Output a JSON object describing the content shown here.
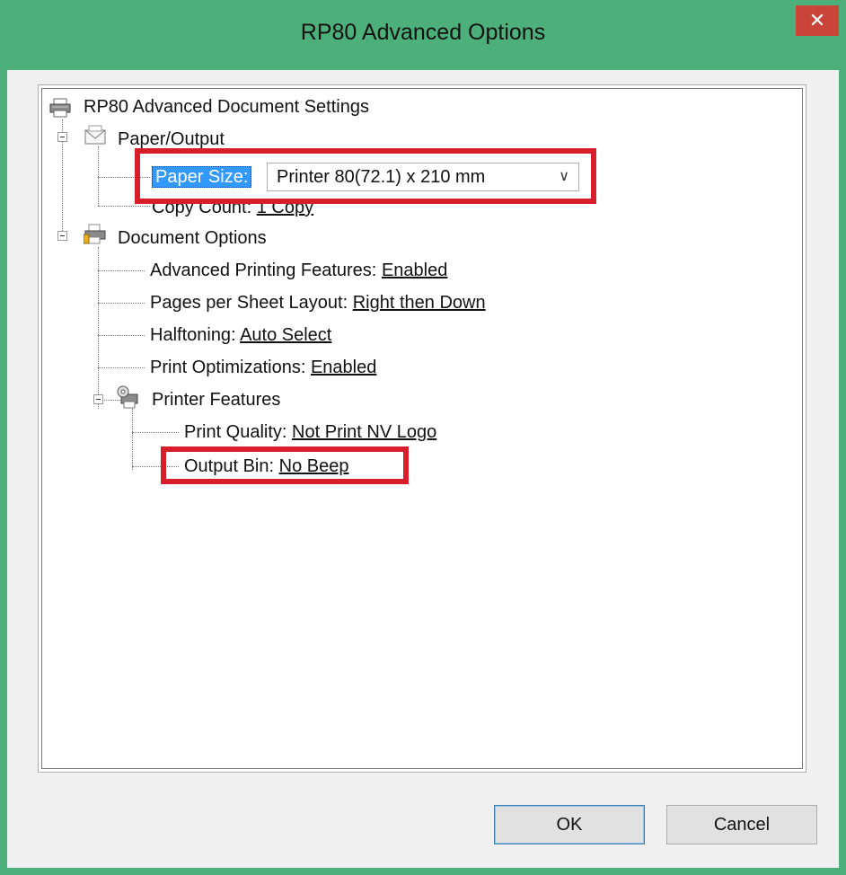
{
  "window": {
    "title": "RP80 Advanced Options",
    "close_label": "✕"
  },
  "tree": {
    "root": "RP80 Advanced Document Settings",
    "paper_output": {
      "label": "Paper/Output",
      "paper_size_label": "Paper Size:",
      "paper_size_value": "Printer 80(72.1) x 210 mm",
      "copy_count_label": "Copy Count:",
      "copy_count_value": "1 Copy"
    },
    "document_options": {
      "label": "Document Options",
      "items": [
        {
          "label": "Advanced Printing Features:",
          "value": "Enabled"
        },
        {
          "label": "Pages per Sheet Layout:",
          "value": "Right then Down"
        },
        {
          "label": "Halftoning:",
          "value": "Auto Select"
        },
        {
          "label": "Print Optimizations:",
          "value": "Enabled"
        }
      ],
      "printer_features": {
        "label": "Printer Features",
        "items": [
          {
            "label": "Print Quality:",
            "value": "Not Print NV Logo"
          },
          {
            "label": "Output Bin:",
            "value": "No Beep"
          }
        ]
      }
    }
  },
  "buttons": {
    "ok": "OK",
    "cancel": "Cancel"
  },
  "colors": {
    "accent_frame": "#4db07b",
    "highlight_box": "#d81e2a",
    "selection": "#3399ff"
  }
}
